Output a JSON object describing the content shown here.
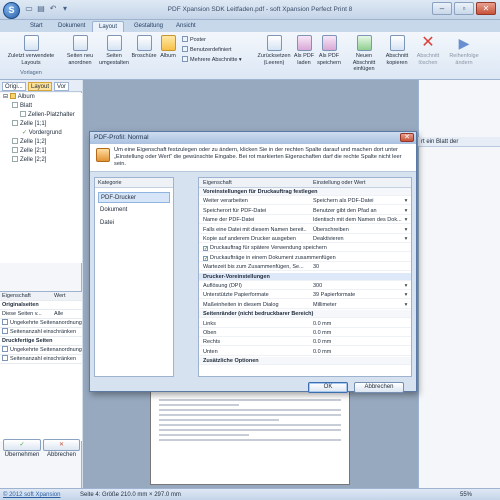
{
  "app": {
    "window_title": "PDF Xpansion SDK Leitfaden.pdf - soft Xpansion Perfect Print 8",
    "logo_letter": "S",
    "tabs": [
      "Start",
      "Dokument",
      "Layout",
      "Gestaltung",
      "Ansicht"
    ],
    "active_tab": "Layout"
  },
  "ribbon": {
    "groups": [
      {
        "label": "Vorlagen",
        "buttons": [
          "Zuletzt verwendete Layouts"
        ]
      },
      {
        "label": "",
        "buttons": [
          "Seiten neu anordnen",
          "Seiten umgestalten",
          "Broschüre",
          "Album"
        ]
      },
      {
        "label": "",
        "small": [
          "Poster",
          "Benutzerdefiniert",
          "Mehrere Abschnitte"
        ]
      },
      {
        "label": "",
        "buttons": [
          "Zurücksetzen (Leeren)",
          "Als PDF laden",
          "Als PDF speichern"
        ]
      },
      {
        "label": "",
        "buttons": [
          "Neuen Abschnitt einfügen",
          "Abschnitt kopieren",
          "Abschnitt löschen",
          "Reihenfolge ändern"
        ]
      }
    ]
  },
  "left_panel": {
    "tabs": [
      "Origi...",
      "Layout",
      "Vor"
    ],
    "tree": [
      {
        "label": "Album",
        "level": 0
      },
      {
        "label": "Blatt",
        "level": 1
      },
      {
        "label": "Zellen-Platzhalter",
        "level": 2
      },
      {
        "label": "Zelle [1;1]",
        "level": 1
      },
      {
        "label": "Vordergrund",
        "level": 2
      },
      {
        "label": "Zelle [1;2]",
        "level": 1
      },
      {
        "label": "Zelle [2;1]",
        "level": 1
      },
      {
        "label": "Zelle [2;2]",
        "level": 1
      }
    ],
    "props_header": [
      "Eigenschaft",
      "Wert"
    ],
    "props": [
      {
        "label": "Originalseiten",
        "bold": true
      },
      {
        "label": "Diese Seiten v...",
        "value": "Alle"
      },
      {
        "label": "Ungekehrte Seitenanordnung",
        "check": true
      },
      {
        "label": "Seitenanzahl einschränken",
        "check": true
      },
      {
        "label": "Druckfertige Seiten",
        "bold": true
      },
      {
        "label": "Ungekehrte Seitenanordnung",
        "check": true
      },
      {
        "label": "Seitenanzahl einschränken",
        "check": true
      }
    ],
    "btn_apply": "Übernehmen",
    "btn_cancel": "Abbrechen"
  },
  "right_panel": {
    "header": "rt ein Blatt der"
  },
  "statusbar": {
    "copyright": "© 2012 soft Xpansion",
    "page_info": "Seite 4: Größe 210.0 mm × 297.0 mm",
    "zoom": "55%"
  },
  "dialog": {
    "title": "PDF-Profil: Normal",
    "info": "Um eine Eigenschaft festzulegen oder zu ändern, klicken Sie in der rechten Spalte darauf und machen dort unter „Einstellung oder Wert“ die gewünschte Eingabe. Bei rot markierten Eigenschaften darf die rechte Spalte nicht leer sein.",
    "category_header": "Kategorie",
    "categories": [
      "PDF-Drucker",
      "Dokument",
      "Datei"
    ],
    "selected_category": "PDF-Drucker",
    "grid_header_prop": "Eigenschaft",
    "grid_header_value": "Einstellung oder Wert",
    "rows": [
      {
        "type": "section",
        "label": "Voreinstellungen für Druckauftrag festlegen"
      },
      {
        "label": "Weiter verarbeiten",
        "value": "Speichern als PDF-Datei",
        "dropdown": true
      },
      {
        "label": "Speicherort für PDF-Datei",
        "value": "Benutzer gibt den Pfad an",
        "dropdown": true
      },
      {
        "label": "Name der PDF-Datei",
        "value": "Identisch mit dem Namen des Dok...",
        "dropdown": true
      },
      {
        "label": "Falls eine Datei mit diesem Namen bereit...",
        "value": "Überschreiben",
        "dropdown": true
      },
      {
        "label": "Kopie auf anderem Drucker ausgeben",
        "value": "Deaktivieren",
        "dropdown": true
      },
      {
        "type": "check",
        "label": "Druckauftrag für spätere Verwendung speichern"
      },
      {
        "type": "check",
        "label": "Druckaufträge in einem Dokument zusammenfügen"
      },
      {
        "label": "Wartezeit bis zum Zusammenfügen, Se...",
        "value": "30"
      },
      {
        "type": "section2",
        "label": "Drucker-Voreinstellungen"
      },
      {
        "label": "Auflösung (DPI)",
        "value": "300",
        "dropdown": true
      },
      {
        "label": "Unterstützte Papierformate",
        "value": "39 Papierformate",
        "dropdown": true
      },
      {
        "label": "Maßeinheiten in diesem Dialog",
        "value": "Millimeter",
        "dropdown": true
      },
      {
        "type": "section",
        "label": "Seitenränder (nicht bedruckbarer Bereich)"
      },
      {
        "label": "Links",
        "value": "0.0 mm"
      },
      {
        "label": "Oben",
        "value": "0.0 mm"
      },
      {
        "label": "Rechts",
        "value": "0.0 mm"
      },
      {
        "label": "Unten",
        "value": "0.0 mm"
      },
      {
        "type": "section",
        "label": "Zusätzliche Optionen"
      }
    ],
    "ok": "OK",
    "cancel": "Abbrechen"
  }
}
